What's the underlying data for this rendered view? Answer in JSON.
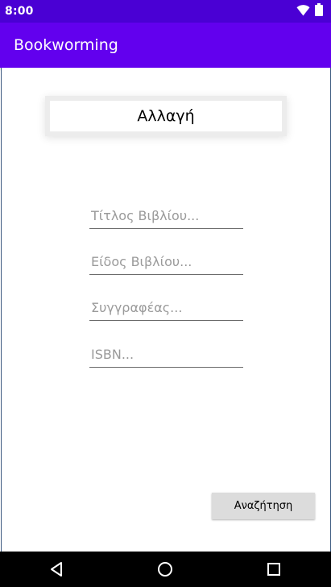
{
  "status_bar": {
    "time": "8:00",
    "icons": [
      "wifi-icon",
      "battery-icon"
    ]
  },
  "app_bar": {
    "title": "Bookworming"
  },
  "form": {
    "change_button_label": "Αλλαγή",
    "fields": [
      {
        "name": "title",
        "value": "",
        "placeholder": "Τίτλος Βιβλίου..."
      },
      {
        "name": "genre",
        "value": "",
        "placeholder": "Είδος Βιβλίου..."
      },
      {
        "name": "author",
        "value": "",
        "placeholder": "Συγγραφέας..."
      },
      {
        "name": "isbn",
        "value": "",
        "placeholder": "ISBN..."
      }
    ],
    "search_button_label": "Αναζήτηση"
  },
  "nav_bar": {
    "icons": [
      "back-icon",
      "home-icon",
      "recents-icon"
    ]
  },
  "colors": {
    "status_bar": "#4a00d4",
    "app_bar": "#6200ee",
    "button_gray": "#dcdcdc"
  }
}
